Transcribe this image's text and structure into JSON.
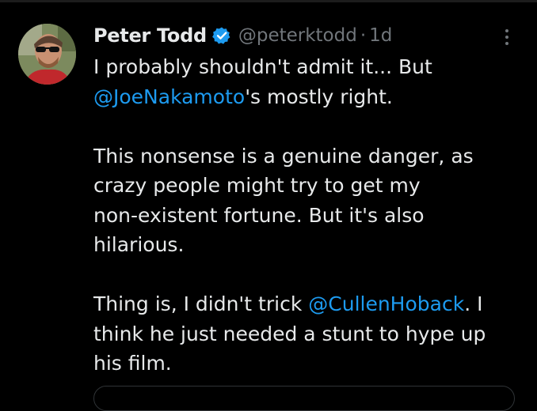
{
  "tweet": {
    "author": {
      "name": "Peter Todd",
      "handle": "@peterktodd",
      "verified": true,
      "avatar_icon": "avatar-photo"
    },
    "separator": "·",
    "time": "1d",
    "more_icon": "more-vertical-icon",
    "body": {
      "p1_line1": "I probably shouldn't admit it... But",
      "p1_mention": "@JoeNakamoto",
      "p1_rest": "'s mostly right.",
      "p2_line1": "This nonsense is a genuine danger, as",
      "p2_line2": "crazy people might try to get my",
      "p2_line3": "non-existent fortune. But it's also",
      "p2_line4": "hilarious.",
      "p3_prefix": "Thing is, I didn't trick ",
      "p3_mention": "@CullenHoback",
      "p3_after": ". I",
      "p3_line2": "think he just needed a stunt to hype up",
      "p3_line3": "his film."
    }
  },
  "colors": {
    "background": "#000000",
    "text": "#e7e9ea",
    "secondary": "#71767b",
    "link": "#1d9bf0",
    "verified_badge": "#1d9bf0"
  }
}
